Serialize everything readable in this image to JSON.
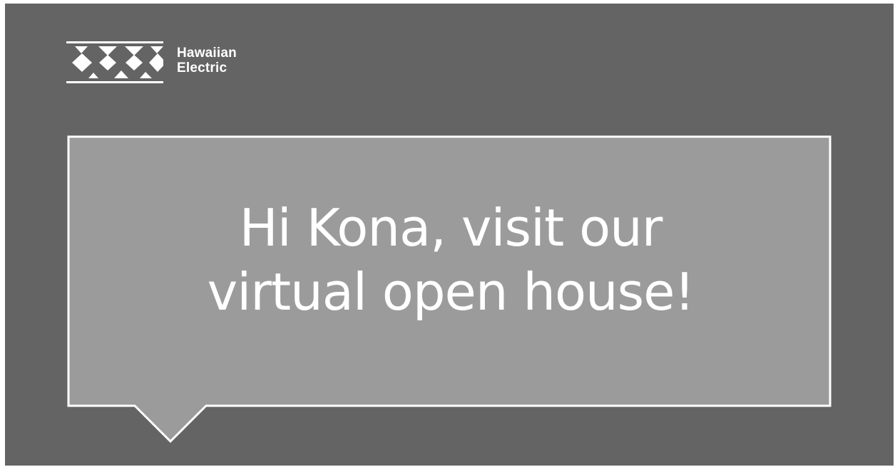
{
  "brand": {
    "logo_icon": "hawaiian-electric-diamond-logo",
    "name_line1": "Hawaiian",
    "name_line2": "Electric"
  },
  "message": {
    "line1": "Hi Kona, visit our",
    "line2": "virtual open house!"
  },
  "colors": {
    "background": "#646464",
    "bubble_fill": "#9b9b9b",
    "foreground": "#ffffff"
  }
}
